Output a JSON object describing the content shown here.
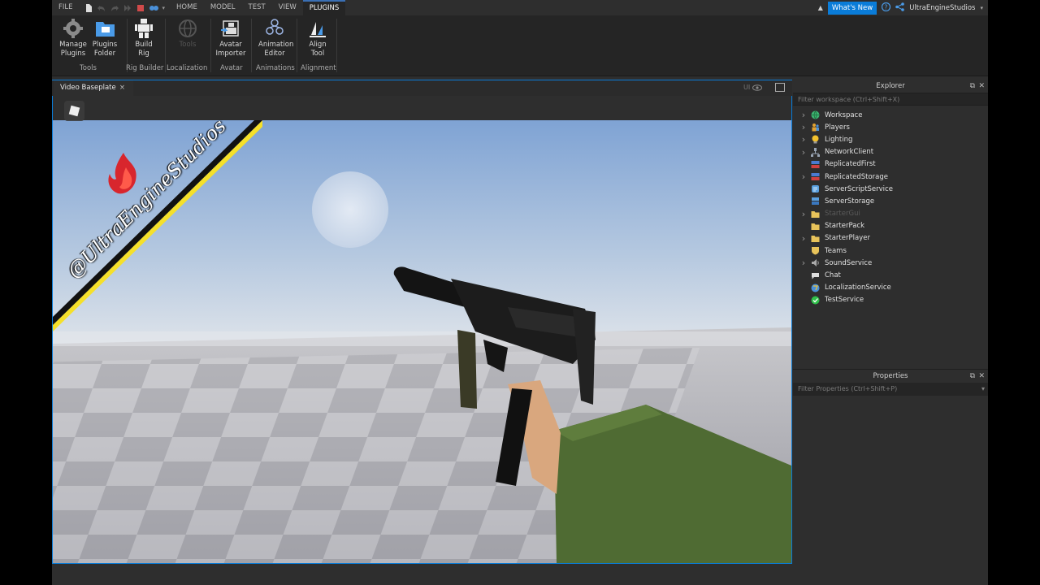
{
  "menubar": {
    "file": "FILE",
    "tabs": [
      "HOME",
      "MODEL",
      "TEST",
      "VIEW",
      "PLUGINS"
    ],
    "active_tab": "PLUGINS",
    "whats_new": "What's New",
    "username": "UltraEngineStudios"
  },
  "ribbon": {
    "manage_plugins": "Manage\nPlugins",
    "plugins_folder": "Plugins\nFolder",
    "tools_group": "Tools",
    "build_rig": "Build\nRig",
    "rig_builder_group": "Rig Builder",
    "tools_disabled": "Tools",
    "localization_group": "Localization",
    "avatar_importer": "Avatar\nImporter",
    "avatar_group": "Avatar",
    "animation_editor": "Animation\nEditor",
    "animations_group": "Animations",
    "align_tool": "Align\nTool",
    "alignment_group": "Alignment"
  },
  "viewport": {
    "tab_title": "Video Baseplate",
    "close": "×",
    "ui_toggle": "UI",
    "watermark": "@UltraEngineStudios"
  },
  "explorer": {
    "title": "Explorer",
    "filter_placeholder": "Filter workspace (Ctrl+Shift+X)",
    "items": [
      {
        "label": "Workspace",
        "expandable": true,
        "icon": "globe-icon",
        "color": "#3cb371"
      },
      {
        "label": "Players",
        "expandable": true,
        "icon": "players-icon",
        "color": "#e0a030"
      },
      {
        "label": "Lighting",
        "expandable": true,
        "icon": "lightbulb-icon",
        "color": "#f2c12e"
      },
      {
        "label": "NetworkClient",
        "expandable": true,
        "icon": "network-icon",
        "color": "#9aa6b5"
      },
      {
        "label": "ReplicatedFirst",
        "expandable": false,
        "icon": "replicated-first-icon",
        "color": "#d04040"
      },
      {
        "label": "ReplicatedStorage",
        "expandable": true,
        "icon": "replicated-storage-icon",
        "color": "#d04040"
      },
      {
        "label": "ServerScriptService",
        "expandable": false,
        "icon": "server-script-icon",
        "color": "#5aa0e0"
      },
      {
        "label": "ServerStorage",
        "expandable": false,
        "icon": "server-storage-icon",
        "color": "#5aa0e0"
      },
      {
        "label": "StarterGui",
        "expandable": true,
        "icon": "folder-icon",
        "color": "#e8c35a",
        "dim": true
      },
      {
        "label": "StarterPack",
        "expandable": false,
        "icon": "folder-icon",
        "color": "#e8c35a"
      },
      {
        "label": "StarterPlayer",
        "expandable": true,
        "icon": "folder-icon",
        "color": "#e8c35a"
      },
      {
        "label": "Teams",
        "expandable": false,
        "icon": "teams-icon",
        "color": "#e8c35a"
      },
      {
        "label": "SoundService",
        "expandable": true,
        "icon": "sound-icon",
        "color": "#aaaaaa"
      },
      {
        "label": "Chat",
        "expandable": false,
        "icon": "chat-icon",
        "color": "#dddddd"
      },
      {
        "label": "LocalizationService",
        "expandable": false,
        "icon": "localization-icon",
        "color": "#4a90d9"
      },
      {
        "label": "TestService",
        "expandable": false,
        "icon": "check-icon",
        "color": "#2fbf4a"
      }
    ]
  },
  "properties": {
    "title": "Properties",
    "filter_placeholder": "Filter Properties (Ctrl+Shift+P)"
  },
  "colors": {
    "accent": "#0a7cd8",
    "panel_bg": "#2e2e2e",
    "ribbon_bg": "#252525",
    "sky_top": "#7fa6d6",
    "sky_bottom": "#d5dde6",
    "stripe_yellow": "#f5e02a"
  }
}
